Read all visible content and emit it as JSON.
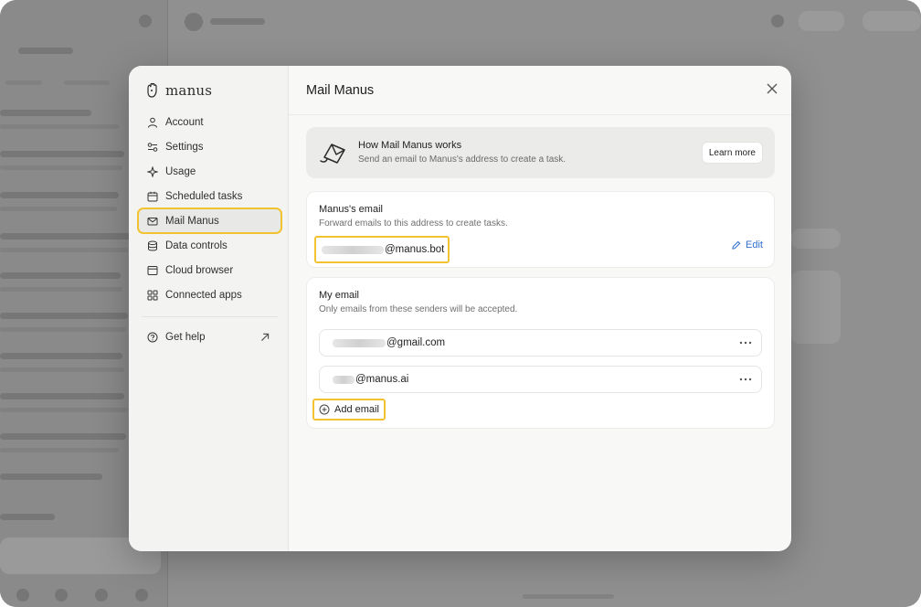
{
  "sidebar": {
    "brand": "manus",
    "items": [
      {
        "label": "Account",
        "icon": "user-icon"
      },
      {
        "label": "Settings",
        "icon": "settings-icon"
      },
      {
        "label": "Usage",
        "icon": "sparkle-icon"
      },
      {
        "label": "Scheduled tasks",
        "icon": "calendar-icon"
      },
      {
        "label": "Mail Manus",
        "icon": "mail-icon",
        "active": true
      },
      {
        "label": "Data controls",
        "icon": "database-icon"
      },
      {
        "label": "Cloud browser",
        "icon": "browser-icon"
      },
      {
        "label": "Connected apps",
        "icon": "apps-grid-icon"
      }
    ],
    "help": {
      "label": "Get help",
      "icon": "help-circle-icon"
    }
  },
  "main": {
    "title": "Mail Manus",
    "info": {
      "title": "How Mail Manus works",
      "subtitle": "Send an email to Manus's address to create a task.",
      "button": "Learn more"
    },
    "manus_email": {
      "title": "Manus's email",
      "subtitle": "Forward emails to this address to create tasks.",
      "address_suffix": "@manus.bot",
      "edit_label": "Edit"
    },
    "my_email": {
      "title": "My email",
      "subtitle": "Only emails from these senders will be accepted.",
      "senders": [
        {
          "suffix": "@gmail.com"
        },
        {
          "suffix": "@manus.ai"
        }
      ],
      "add_label": "Add email"
    }
  },
  "colors": {
    "highlight": "#f2c230",
    "link": "#2f6fce"
  }
}
